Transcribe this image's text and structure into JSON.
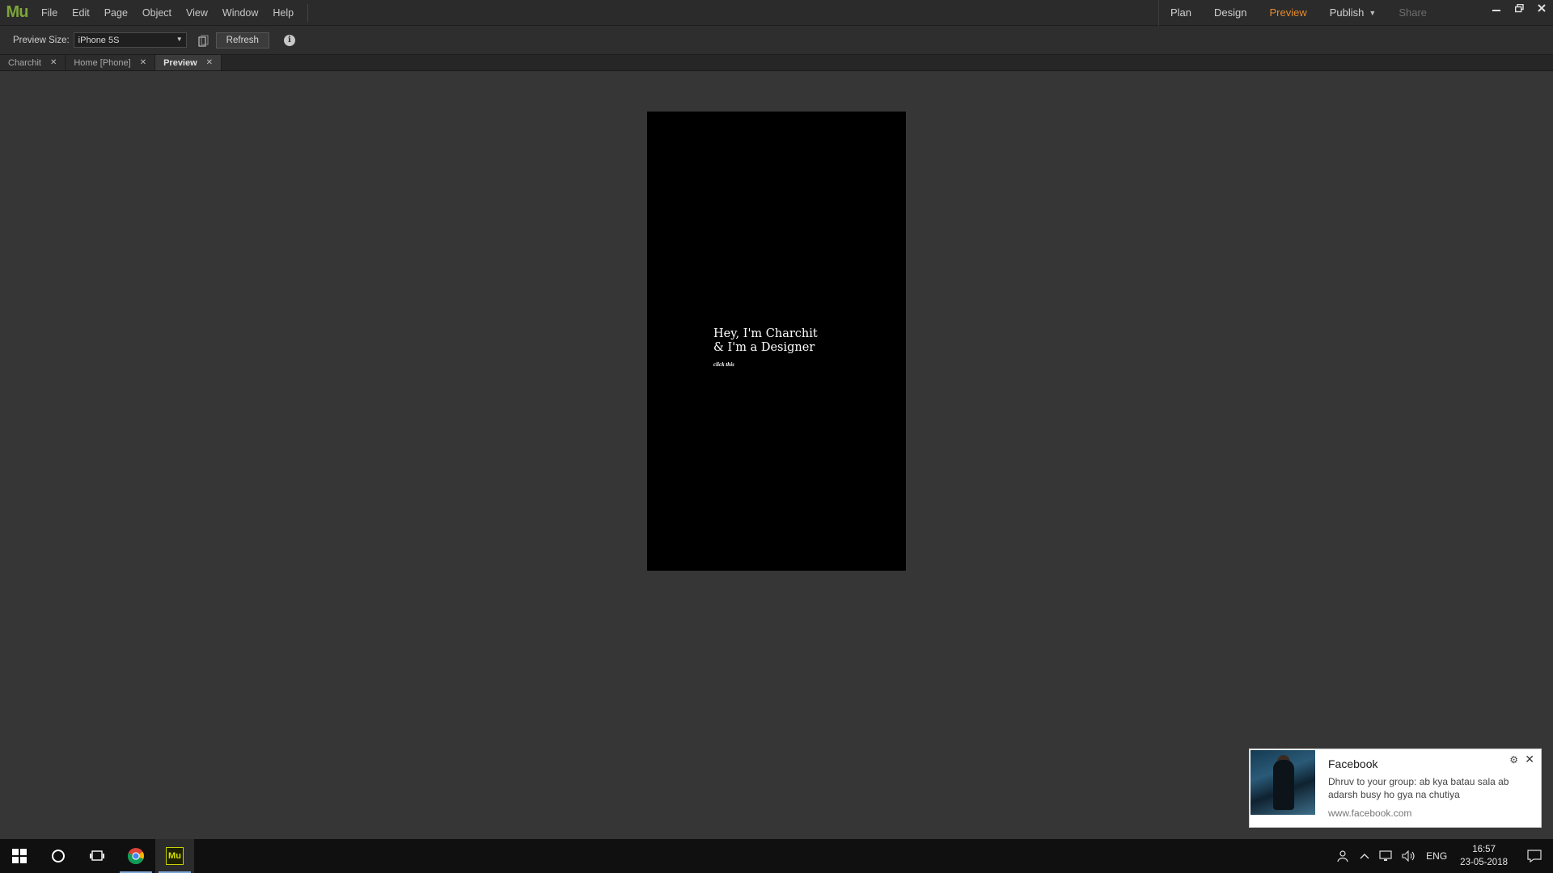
{
  "app": {
    "logo": "Mu"
  },
  "menu": [
    "File",
    "Edit",
    "Page",
    "Object",
    "View",
    "Window",
    "Help"
  ],
  "modes": {
    "plan": "Plan",
    "design": "Design",
    "preview": "Preview",
    "publish": "Publish",
    "share": "Share"
  },
  "toolbar": {
    "preview_size_label": "Preview Size:",
    "preview_size_value": "iPhone 5S",
    "refresh_label": "Refresh",
    "info_glyph": "i"
  },
  "doc_tabs": [
    {
      "label": "Charchit",
      "active": false
    },
    {
      "label": "Home [Phone]",
      "active": false
    },
    {
      "label": "Preview",
      "active": true
    }
  ],
  "phone": {
    "headline_line1": "Hey, I'm Charchit",
    "headline_line2": "& I'm a Designer",
    "link": "click this"
  },
  "notification": {
    "app": "Facebook",
    "message": "Dhruv to your group: ab kya batau sala ab adarsh busy ho gya na chutiya",
    "source": "www.facebook.com"
  },
  "taskbar": {
    "language": "ENG",
    "time": "16:57",
    "date": "23-05-2018"
  },
  "colors": {
    "accent_preview": "#e48a2c",
    "muse_logo": "#7ea43a",
    "canvas_bg": "#363636",
    "phone_bg": "#000000"
  }
}
